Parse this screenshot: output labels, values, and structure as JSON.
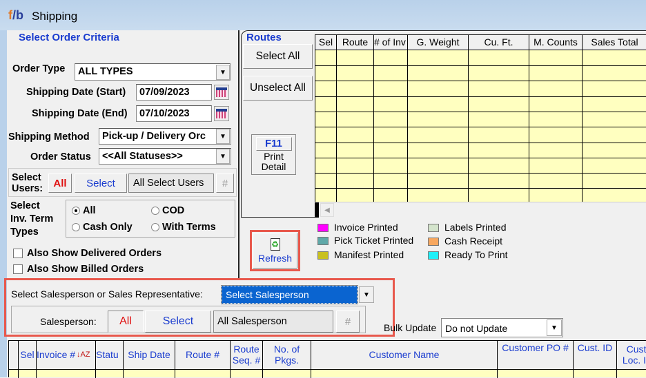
{
  "window": {
    "title": "Shipping",
    "logo": "f/b"
  },
  "criteria": {
    "heading": "Select Order Criteria",
    "order_type_label": "Order Type",
    "order_type_value": "ALL TYPES",
    "ship_start_label": "Shipping Date (Start)",
    "ship_start_value": "07/09/2023",
    "ship_end_label": "Shipping Date (End)",
    "ship_end_value": "07/10/2023",
    "ship_method_label": "Shipping Method",
    "ship_method_value": "Pick-up / Delivery Orc",
    "order_status_label": "Order Status",
    "order_status_value": "<<All Statuses>>",
    "users_label_1": "Select",
    "users_label_2": "Users:",
    "users_all": "All",
    "users_select": "Select",
    "users_value": "All Select Users",
    "users_hash": "#",
    "term_label_1": "Select",
    "term_label_2": "Inv. Term",
    "term_label_3": "Types",
    "term_options": [
      {
        "label": "All",
        "checked": true
      },
      {
        "label": "COD",
        "checked": false
      },
      {
        "label": "Cash Only",
        "checked": false
      },
      {
        "label": "With Terms",
        "checked": false
      }
    ],
    "delivered_label": "Also Show Delivered Orders",
    "delivered_checked": false,
    "billed_label": "Also Show Billed Orders",
    "billed_checked": false
  },
  "salesperson": {
    "select_label": "Select Salesperson or Sales Representative:",
    "select_value": "Select Salesperson",
    "sp_label": "Salesperson:",
    "sp_all": "All",
    "sp_select": "Select",
    "sp_value": "All Salesperson",
    "sp_hash": "#",
    "highlight_color": "#e8584c"
  },
  "routes": {
    "heading": "Routes",
    "select_all": "Select All",
    "unselect_all": "Unselect All",
    "f11_key": "F11",
    "f11_label_1": "Print",
    "f11_label_2": "Detail",
    "columns": [
      "Sel",
      "Route",
      "# of Inv",
      "G. Weight",
      "Cu. Ft.",
      "M. Counts",
      "Sales Total"
    ]
  },
  "refresh": {
    "label": "Refresh"
  },
  "legend": [
    {
      "label": "Invoice Printed",
      "color": "#ff00ff"
    },
    {
      "label": "Labels Printed",
      "color": "#d4e4cc"
    },
    {
      "label": "Pick Ticket Printed",
      "color": "#5fa8a8"
    },
    {
      "label": "Cash Receipt",
      "color": "#f8a860"
    },
    {
      "label": "Manifest Printed",
      "color": "#c8c020"
    },
    {
      "label": "Ready To Print",
      "color": "#20f0f8"
    }
  ],
  "bulk_update": {
    "label": "Bulk Update",
    "value": "Do not Update"
  },
  "orders": {
    "columns": [
      "Sel",
      "Invoice #",
      "Statu",
      "Ship Date",
      "Route #",
      "Route Seq. #",
      "No. of Pkgs.",
      "Customer Name",
      "Customer PO #",
      "Cust. ID",
      "Cust. Loc. ID"
    ]
  }
}
